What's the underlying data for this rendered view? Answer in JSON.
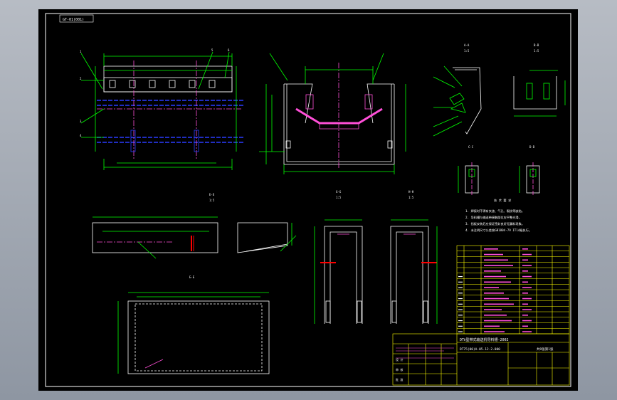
{
  "colors": {
    "background": "#000000",
    "frame": "#ffffff",
    "outline": "#ffffff",
    "dimension": "#00ff00",
    "centerline": "#ff4fd8",
    "hidden": "#2a3cff",
    "section": "#ff0000",
    "title_block": "#ffff00",
    "annotation": "#ff4fd8",
    "note_text": "#ffffff"
  },
  "drawing": {
    "drawing_number_top": "GT-01(001)",
    "title_block": {
      "title": "DTⅡ型带式输送机导料槽-2002",
      "code": "DT75(00)A-05.12-2.000",
      "sheet": "共9张第1张",
      "designer": "设 计",
      "checker": "审 核",
      "approver": "批 准"
    },
    "view_labels": {
      "detail_A": "A-A",
      "detail_B": "B-B",
      "detail_C": "C-C",
      "detail_D": "D-D",
      "detail_E": "E-E",
      "detail_F": "F-F",
      "detail_G": "G-G",
      "detail_H": "H-H",
      "scale": "1:5"
    },
    "notes_heading": "技 术 要 求",
    "notes": [
      "1. 焊接时不得有夹渣、气孔、裂纹等缺陷。",
      "2. 导料槽与输送带接触部位应平整光滑。",
      "3. 挡板安装后应保证密封良好无漏料现象。",
      "4. 未注明尺寸公差按GB1804-79 IT14级执行。"
    ],
    "part_callouts": [
      "1",
      "2",
      "3",
      "4",
      "5",
      "6"
    ]
  }
}
